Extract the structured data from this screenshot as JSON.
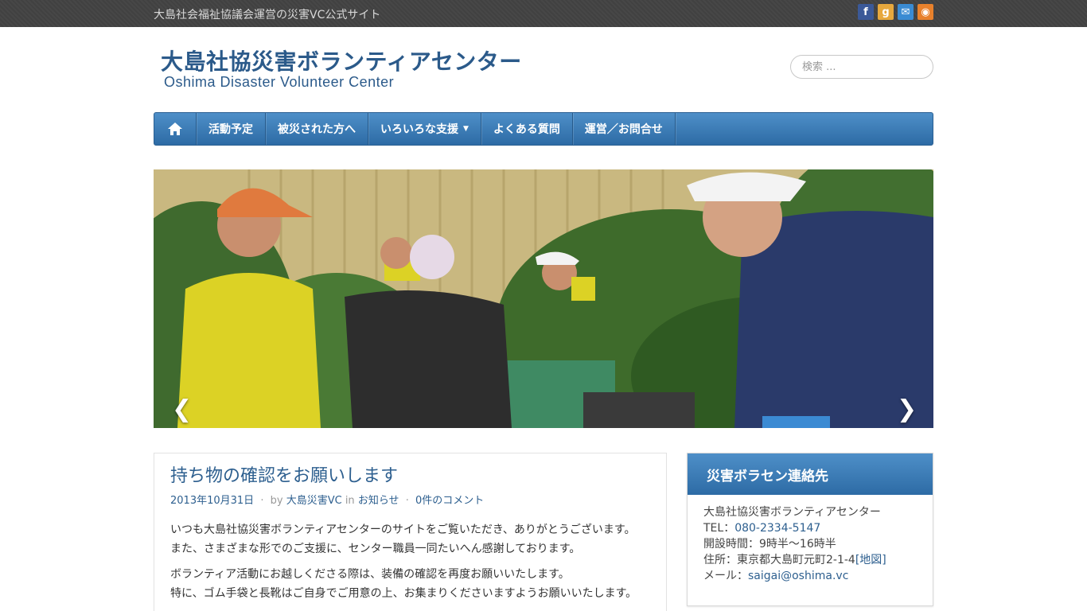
{
  "topbar": {
    "tagline": "大島社会福祉協議会運営の災害VC公式サイト",
    "social": [
      {
        "name": "facebook-icon",
        "glyph": "f",
        "color": "#3b5998"
      },
      {
        "name": "google-icon",
        "glyph": "g",
        "color": "#e7a83d"
      },
      {
        "name": "mail-icon",
        "glyph": "✉",
        "color": "#3a8bd3"
      },
      {
        "name": "rss-icon",
        "glyph": "◉",
        "color": "#e8812c"
      }
    ]
  },
  "header": {
    "logo_jp": "大島社協災害ボランティアセンター",
    "logo_en": "Oshima Disaster Volunteer Center",
    "search_placeholder": "検索 ..."
  },
  "nav": {
    "home_icon": "⌂",
    "items": [
      "活動予定",
      "被災された方へ",
      "いろいろな支援",
      "よくある質問",
      "運営／お問合せ"
    ],
    "dropdown_caret": "▼"
  },
  "slider": {
    "prev": "❮",
    "next": "❯"
  },
  "post": {
    "title": "持ち物の確認をお願いします",
    "date": "2013年10月31日",
    "by": "by",
    "author": "大島災害VC",
    "in": "in",
    "category": "お知らせ",
    "comments": "0件のコメント",
    "para1": "いつも大島社協災害ボランティアセンターのサイトをご覧いただき、ありがとうございます。",
    "para1b": "また、さまざまな形でのご支援に、センター職員一同たいへん感謝しております。",
    "para2": "ボランティア活動にお越しくださる際は、装備の確認を再度お願いいたします。",
    "para3": "特に、ゴム手袋と長靴はご自身でご用意の上、お集まりくださいますようお願いいたします。"
  },
  "widget": {
    "title": "災害ボラセン連絡先",
    "org": "大島社協災害ボランティアセンター",
    "tel_label": "TEL：",
    "tel": "080-2334-5147",
    "hours": "開設時間：9時半〜16時半",
    "addr_label": "住所：東京都大島町元町2-1-4",
    "map_link": "[地図]",
    "mail_label": "メール：",
    "mail": "saigai@oshima.vc"
  }
}
